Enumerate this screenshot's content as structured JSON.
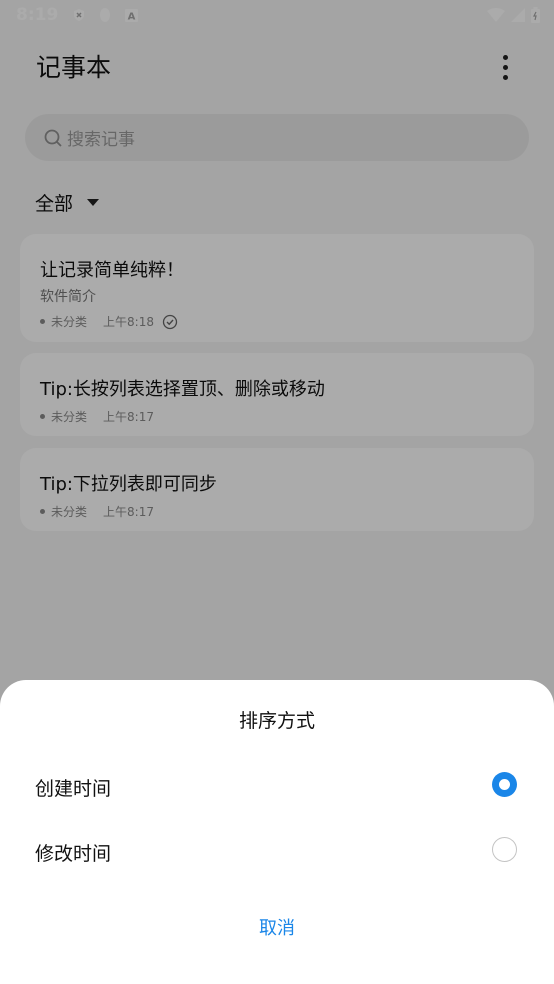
{
  "status_bar": {
    "time": "8:19",
    "icons": [
      "shield-x-icon",
      "penguin-icon",
      "a-box-icon",
      "wifi-icon",
      "signal-icon",
      "battery-icon"
    ]
  },
  "app": {
    "title": "记事本",
    "search": {
      "placeholder": "搜索记事"
    },
    "filter": {
      "label": "全部"
    },
    "notes": [
      {
        "title": "让记录简单纯粹！",
        "subtitle": "软件简介",
        "category": "未分类",
        "time": "上午8:18",
        "synced": true
      },
      {
        "title": "Tip:长按列表选择置顶、删除或移动",
        "subtitle": "",
        "category": "未分类",
        "time": "上午8:17",
        "synced": false
      },
      {
        "title": "Tip:下拉列表即可同步",
        "subtitle": "",
        "category": "未分类",
        "time": "上午8:17",
        "synced": false
      }
    ]
  },
  "sort_sheet": {
    "title": "排序方式",
    "options": [
      {
        "label": "创建时间",
        "selected": true
      },
      {
        "label": "修改时间",
        "selected": false
      }
    ],
    "cancel_label": "取消"
  },
  "colors": {
    "accent": "#1a86e8",
    "overlay": "rgba(0,0,0,0.33)"
  }
}
